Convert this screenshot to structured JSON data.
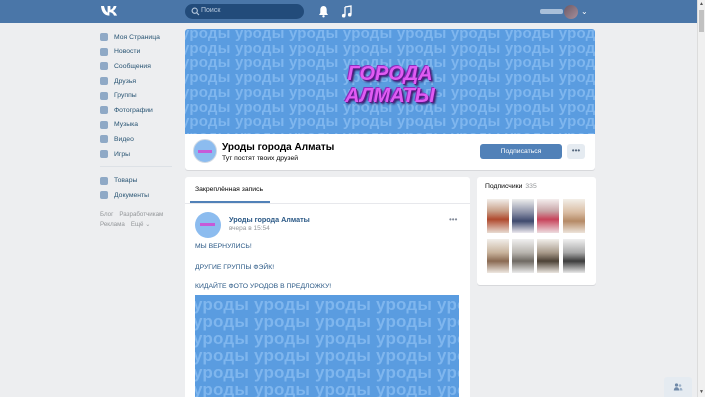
{
  "header": {
    "search_placeholder": "Поиск",
    "accent": "#4a76a8"
  },
  "sidebar": {
    "items": [
      {
        "label": "Моя Страница",
        "icon": "home-icon"
      },
      {
        "label": "Новости",
        "icon": "news-icon"
      },
      {
        "label": "Сообщения",
        "icon": "messages-icon"
      },
      {
        "label": "Друзья",
        "icon": "friends-icon"
      },
      {
        "label": "Группы",
        "icon": "groups-icon"
      },
      {
        "label": "Фотографии",
        "icon": "photos-icon"
      },
      {
        "label": "Музыка",
        "icon": "music-icon"
      },
      {
        "label": "Видео",
        "icon": "video-icon"
      },
      {
        "label": "Игры",
        "icon": "games-icon"
      }
    ],
    "items2": [
      {
        "label": "Товары",
        "icon": "goods-icon"
      },
      {
        "label": "Документы",
        "icon": "documents-icon"
      }
    ],
    "footer": [
      "Блог",
      "Разработчикам",
      "Реклама",
      "Ещё ⌄"
    ]
  },
  "group": {
    "cover_pattern_word": "уроды",
    "cover_title_line1": "ГОРОДА",
    "cover_title_line2": "АЛМАТЫ",
    "name": "Уроды города Алматы",
    "status": "Тут постят твоих друзей",
    "subscribe_label": "Подписаться",
    "more_label": "•••"
  },
  "post": {
    "tab_label": "Закреплённая запись",
    "author": "Уроды города Алматы",
    "time": "вчера в 15:54",
    "more_label": "•••",
    "lines": [
      "МЫ ВЕРНУЛИСЬ!",
      "ДРУГИЕ ГРУППЫ ФЭЙК!",
      "КИДАЙТЕ ФОТО УРОДОВ В ПРЕДЛОЖКУ!"
    ]
  },
  "members": {
    "title": "Подписчики",
    "count": "335"
  }
}
